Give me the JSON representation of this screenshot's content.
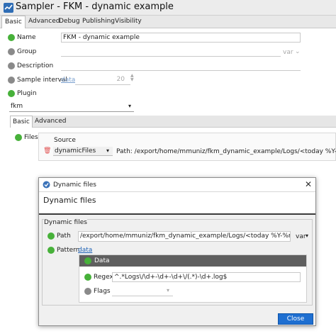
{
  "window": {
    "title": "Sampler - FKM - dynamic example"
  },
  "tabs": [
    "Basic",
    "Advanced",
    "Debug",
    "Publishing",
    "Visibility"
  ],
  "form": {
    "name_label": "Name",
    "name_value": "FKM - dynamic example",
    "group_label": "Group",
    "group_suffix": "var",
    "description_label": "Description",
    "sample_interval_label": "Sample interval",
    "sample_interval_data": "data",
    "sample_interval_value": "20",
    "plugin_label": "Plugin",
    "plugin_value": "fkm"
  },
  "subtabs": [
    "Basic",
    "Advanced"
  ],
  "files": {
    "label": "Files",
    "source_header": "Source",
    "source_value": "dynamicFiles",
    "path_text": "Path: /export/home/mmuniz/fkm_dynamic_example/Logs/<today %Y-%m-%d>/*.log, P"
  },
  "dialog": {
    "title": "Dynamic files",
    "header": "Dynamic files",
    "group_title": "Dynamic files",
    "path_label": "Path",
    "path_value": "/export/home/mmuniz/fkm_dynamic_example/Logs/<today %Y-%m-%d>/*.log",
    "path_suffix": "var",
    "pattern_label": "Pattern",
    "pattern_link": "data",
    "data_header": "Data",
    "regex_label": "Regex",
    "regex_value": "^.*Logs\\/\\d+-\\d+-\\d+\\/(.*)-\\d+.log$",
    "flags_label": "Flags",
    "close_label": "Close"
  },
  "colors": {
    "green": "#47b13a",
    "gray": "#8a8a8a",
    "accent": "#1e6fd1"
  }
}
